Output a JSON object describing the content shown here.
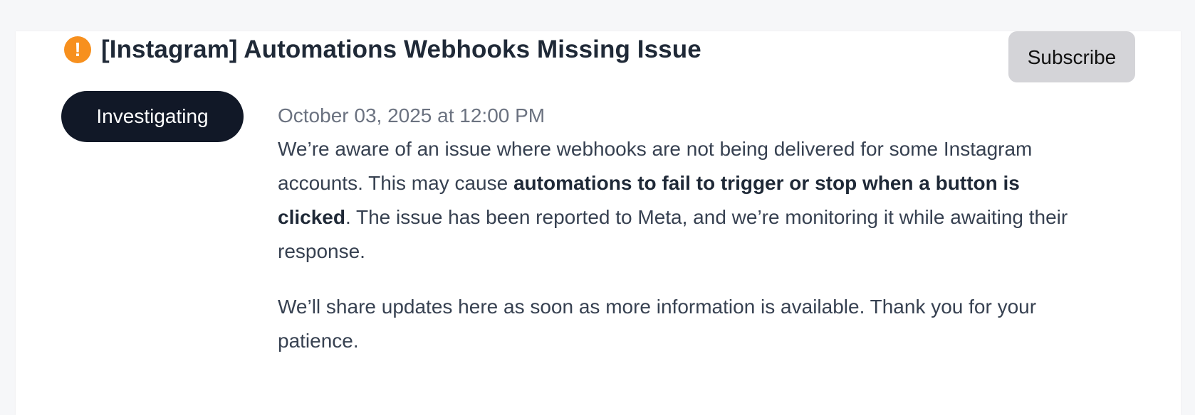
{
  "incident": {
    "icon": "alert-icon",
    "icon_glyph": "!",
    "icon_color": "#f7901e",
    "title": "[Instagram] Automations Webhooks Missing Issue",
    "subscribe_label": "Subscribe",
    "status": "Investigating",
    "status_color": "#111827"
  },
  "update": {
    "timestamp": "October 03, 2025 at 12:00 PM",
    "p1_part1": "We’re aware of an issue where webhooks are not being delivered for some Instagram accounts. This may cause ",
    "p1_bold": "automations to fail to trigger or stop when a button is clicked",
    "p1_part2": ". The issue has been reported to Meta, and we’re monitoring it while awaiting their response.",
    "p2": "We’ll share updates here as soon as more information is available. Thank you for your patience."
  }
}
